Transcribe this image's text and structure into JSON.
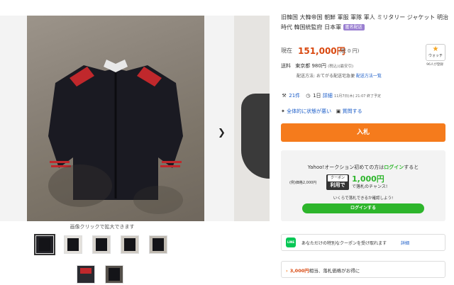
{
  "gallery": {
    "caption": "画像クリックで拡大できます",
    "next_arrow": "❯",
    "thumbnails": [
      "thumb-1",
      "thumb-2",
      "thumb-3",
      "thumb-4",
      "thumb-5",
      "thumb-6",
      "thumb-7"
    ]
  },
  "item": {
    "title": "旧韓国 大韓帝国 朝鮮 軍服 軍隊 軍人 ミリタリー ジャケット 明治時代 韓国統監府 日本軍",
    "badge": "匿名配送"
  },
  "price": {
    "label": "現在",
    "value": "151,000円",
    "tax": "(税 0 円)"
  },
  "watch": {
    "star": "★",
    "label": "ウォッチ",
    "count": "96人が登録"
  },
  "shipping": {
    "label": "送料",
    "destination": "東京都",
    "cost": "980円",
    "note": "(税込)(最安引)",
    "method_label": "配送方法:",
    "method": "おてがる配送宅急便",
    "method_link": "配送方法一覧"
  },
  "meta": {
    "bids": "21件",
    "time_left": "1日",
    "detail_link": "詳細",
    "end_time": "11月7日(木) 21:07 終了予定"
  },
  "meta2": {
    "condition_link": "全体的に状態が悪い",
    "question_link": "質問する"
  },
  "bid_button": "入札",
  "promo": {
    "line1_prefix": "Yahoo!オークション初めての方は",
    "line1_login": "ログイン",
    "line1_suffix": "すると",
    "price_label": "(例)価格2,000円",
    "coupon_top": "クーポン",
    "coupon_bottom": "利用で",
    "amount": "1,000円",
    "amount_sub": "で落札のチャンス!",
    "line3": "いくらで落札できるか確認しよう!",
    "login_button": "ログインする"
  },
  "line_coupon": {
    "icon": "LINE",
    "text": "あなただけの特別なクーポンを受け取れます",
    "link": "詳細"
  },
  "savings": {
    "chevron": "›",
    "amount": "3,000円",
    "text": "相当、落札価格がお得に"
  },
  "colors": {
    "price": "#d9480f",
    "bid_button": "#f57b1c",
    "promo_green": "#2db52b",
    "link": "#1a5cc8",
    "badge": "#9a7fd1"
  }
}
